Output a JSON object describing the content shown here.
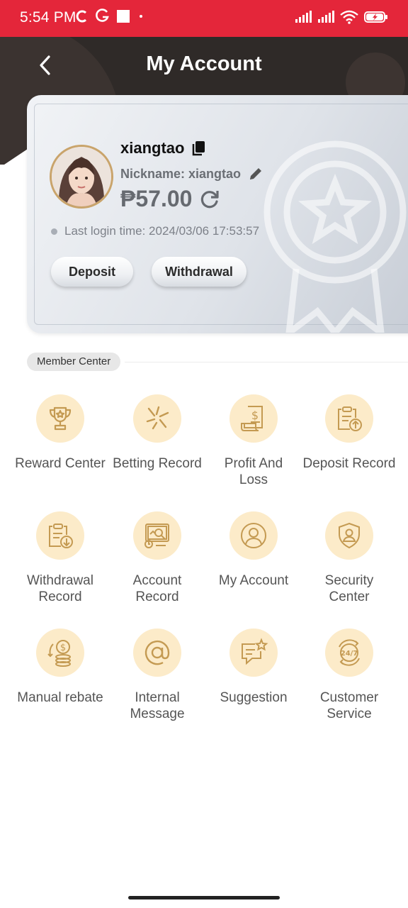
{
  "status_bar": {
    "time": "5:54 PM",
    "app_icons": [
      "sync-icon",
      "google-icon",
      "square-icon",
      "dot-icon"
    ],
    "right_icons": [
      "signal-icon",
      "signal-icon",
      "wifi-icon",
      "battery-charging-icon"
    ]
  },
  "header": {
    "title": "My Account"
  },
  "account": {
    "username": "xiangtao",
    "nickname": "Nickname: xiangtao",
    "balance": "₱57.00",
    "last_login": "Last login time: 2024/03/06 17:53:57",
    "deposit_label": "Deposit",
    "withdrawal_label": "Withdrawal"
  },
  "member_center": {
    "title": "Member Center",
    "items": [
      {
        "label": "Reward Center",
        "icon": "trophy-icon"
      },
      {
        "label": "Betting Record",
        "icon": "sparkle-icon"
      },
      {
        "label": "Profit And\nLoss",
        "icon": "receipt-icon"
      },
      {
        "label": "Deposit Record",
        "icon": "clipboard-upload-icon"
      },
      {
        "label": "Withdrawal\nRecord",
        "icon": "clipboard-download-icon"
      },
      {
        "label": "Account\nRecord",
        "icon": "monitor-search-icon"
      },
      {
        "label": "My Account",
        "icon": "user-circle-icon"
      },
      {
        "label": "Security\nCenter",
        "icon": "shield-user-icon"
      },
      {
        "label": "Manual rebate",
        "icon": "coins-icon"
      },
      {
        "label": "Internal\nMessage",
        "icon": "at-icon"
      },
      {
        "label": "Suggestion",
        "icon": "chat-star-icon"
      },
      {
        "label": "Customer\nService",
        "icon": "support-24-7-icon"
      }
    ]
  },
  "colors": {
    "status_bar": "#e4263a",
    "header_bg": "#2f2a28",
    "icon_circle": "#fcebc9",
    "icon_stroke": "#c49a52",
    "avatar_border": "#c9a46b"
  }
}
